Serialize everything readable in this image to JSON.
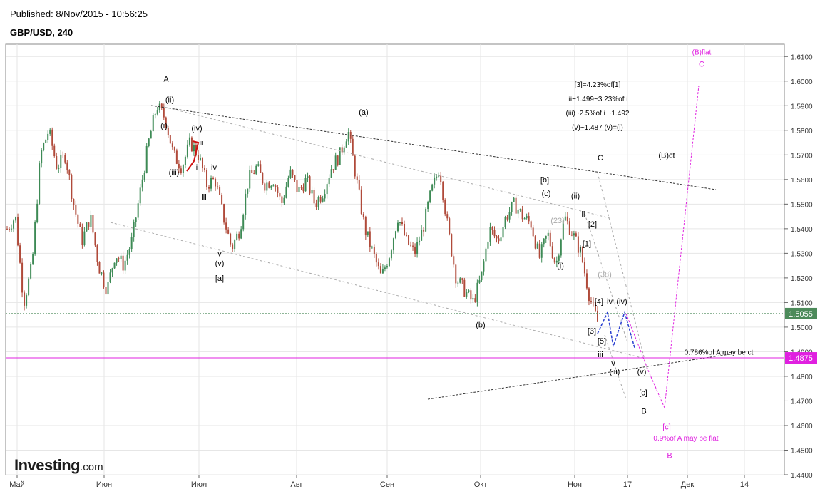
{
  "header": {
    "published": "Published: 8/Nov/2015 - 10:56:25",
    "symbol": "GBP/USD, 240"
  },
  "logo": {
    "brand": "Investing",
    "suffix": ".com"
  },
  "colors": {
    "up": "#3d8a55",
    "down": "#b04a3a",
    "magenta": "#e020e0",
    "current_price_bg": "#4c8a5a",
    "grid": "#e6e6e6",
    "blue_path": "#2a3fd0"
  },
  "chart_data": {
    "type": "candlestick",
    "ylim": [
      1.44,
      1.615
    ],
    "yticks": [
      "1.4400",
      "1.4500",
      "1.4600",
      "1.4700",
      "1.4800",
      "1.4900",
      "1.5000",
      "1.5100",
      "1.5200",
      "1.5300",
      "1.5400",
      "1.5500",
      "1.5600",
      "1.5700",
      "1.5800",
      "1.5900",
      "1.6000",
      "1.6100"
    ],
    "xticks": [
      "Май",
      "Июн",
      "Июл",
      "Авг",
      "Сен",
      "Окт",
      "Ноя",
      "17",
      "Дек",
      "14"
    ],
    "grid": true,
    "current_price": {
      "label": "1.5055",
      "value": 1.5055
    },
    "horizontal_level": {
      "label": "1.4875",
      "value": 1.4875
    },
    "price_path": [
      1.54,
      1.545,
      1.51,
      1.525,
      1.57,
      1.58,
      1.565,
      1.57,
      1.55,
      1.535,
      1.545,
      1.525,
      1.515,
      1.53,
      1.525,
      1.535,
      1.555,
      1.575,
      1.59,
      1.585,
      1.57,
      1.565,
      1.575,
      1.57,
      1.558,
      1.56,
      1.545,
      1.532,
      1.54,
      1.56,
      1.565,
      1.558,
      1.56,
      1.55,
      1.563,
      1.555,
      1.56,
      1.55,
      1.555,
      1.565,
      1.57,
      1.58,
      1.56,
      1.54,
      1.53,
      1.52,
      1.53,
      1.545,
      1.535,
      1.53,
      1.54,
      1.555,
      1.565,
      1.54,
      1.52,
      1.515,
      1.51,
      1.52,
      1.54,
      1.535,
      1.545,
      1.55,
      1.545,
      1.542,
      1.528,
      1.538,
      1.525,
      1.545,
      1.538,
      1.53,
      1.513,
      1.502
    ],
    "annotations": [
      {
        "text": "A",
        "v": 1.601,
        "color": "#000"
      },
      {
        "text": "(ii)",
        "v": 1.5925,
        "color": "#000"
      },
      {
        "text": "(i)",
        "v": 1.582,
        "color": "#000"
      },
      {
        "text": "(iv)",
        "v": 1.581,
        "color": "#000"
      },
      {
        "text": "ii",
        "v": 1.575,
        "color": "#000"
      },
      {
        "text": "i",
        "v": 1.565,
        "color": "#000"
      },
      {
        "text": "(iii)",
        "v": 1.563,
        "color": "#000"
      },
      {
        "text": "iv",
        "v": 1.565,
        "color": "#000"
      },
      {
        "text": "iii",
        "v": 1.553,
        "color": "#000"
      },
      {
        "text": "v",
        "v": 1.53,
        "color": "#000"
      },
      {
        "text": "(v)",
        "v": 1.526,
        "color": "#000"
      },
      {
        "text": "[a]",
        "v": 1.52,
        "color": "#000"
      },
      {
        "text": "(a)",
        "v": 1.5875,
        "color": "#000"
      },
      {
        "text": "(b)",
        "v": 1.501,
        "color": "#000"
      },
      {
        "text": "[b]",
        "v": 1.56,
        "color": "#000"
      },
      {
        "text": "(c)",
        "v": 1.5545,
        "color": "#000"
      },
      {
        "text": "(23)",
        "v": 1.5435,
        "color": "#aaa"
      },
      {
        "text": "(ii)",
        "v": 1.5535,
        "color": "#000"
      },
      {
        "text": "ii",
        "v": 1.546,
        "color": "#000"
      },
      {
        "text": "[2]",
        "v": 1.542,
        "color": "#000"
      },
      {
        "text": "[1]",
        "v": 1.534,
        "color": "#000"
      },
      {
        "text": "i",
        "v": 1.532,
        "color": "#000"
      },
      {
        "text": "(i)",
        "v": 1.525,
        "color": "#000"
      },
      {
        "text": "(38)",
        "v": 1.5215,
        "color": "#aaa"
      },
      {
        "text": "[4]",
        "v": 1.5105,
        "color": "#000"
      },
      {
        "text": "iv",
        "v": 1.5105,
        "color": "#000"
      },
      {
        "text": "(iv)",
        "v": 1.5105,
        "color": "#000"
      },
      {
        "text": "[3]",
        "v": 1.4985,
        "color": "#000"
      },
      {
        "text": "[5]",
        "v": 1.4945,
        "color": "#000"
      },
      {
        "text": "iii",
        "v": 1.489,
        "color": "#000"
      },
      {
        "text": "v",
        "v": 1.4855,
        "color": "#000"
      },
      {
        "text": "(iii)",
        "v": 1.482,
        "color": "#000"
      },
      {
        "text": "(v)",
        "v": 1.482,
        "color": "#000"
      },
      {
        "text": "[c]",
        "v": 1.4735,
        "color": "#000"
      },
      {
        "text": "B",
        "v": 1.466,
        "color": "#000"
      },
      {
        "text": "C",
        "v": 1.569,
        "color": "#000"
      },
      {
        "text": "(B)ct",
        "v": 1.57,
        "color": "#000"
      },
      {
        "text": "(B)flat",
        "v": 1.612,
        "color": "#e020e0"
      },
      {
        "text": "C",
        "v": 1.607,
        "color": "#e020e0"
      },
      {
        "text": "0.786%of A may be ct",
        "v": 1.49,
        "color": "#000"
      },
      {
        "text": "[c]",
        "v": 1.4595,
        "color": "#e020e0"
      },
      {
        "text": "0.9%of A may be flat",
        "v": 1.455,
        "color": "#e020e0"
      },
      {
        "text": "B",
        "v": 1.448,
        "color": "#e020e0"
      }
    ],
    "notes": [
      "[3]=4.23%of[1]",
      "iii~1.499~3.23%of i",
      "(iii)~2.5%of i ~1.492",
      "(v)~1.487 (v)=(i)"
    ]
  }
}
